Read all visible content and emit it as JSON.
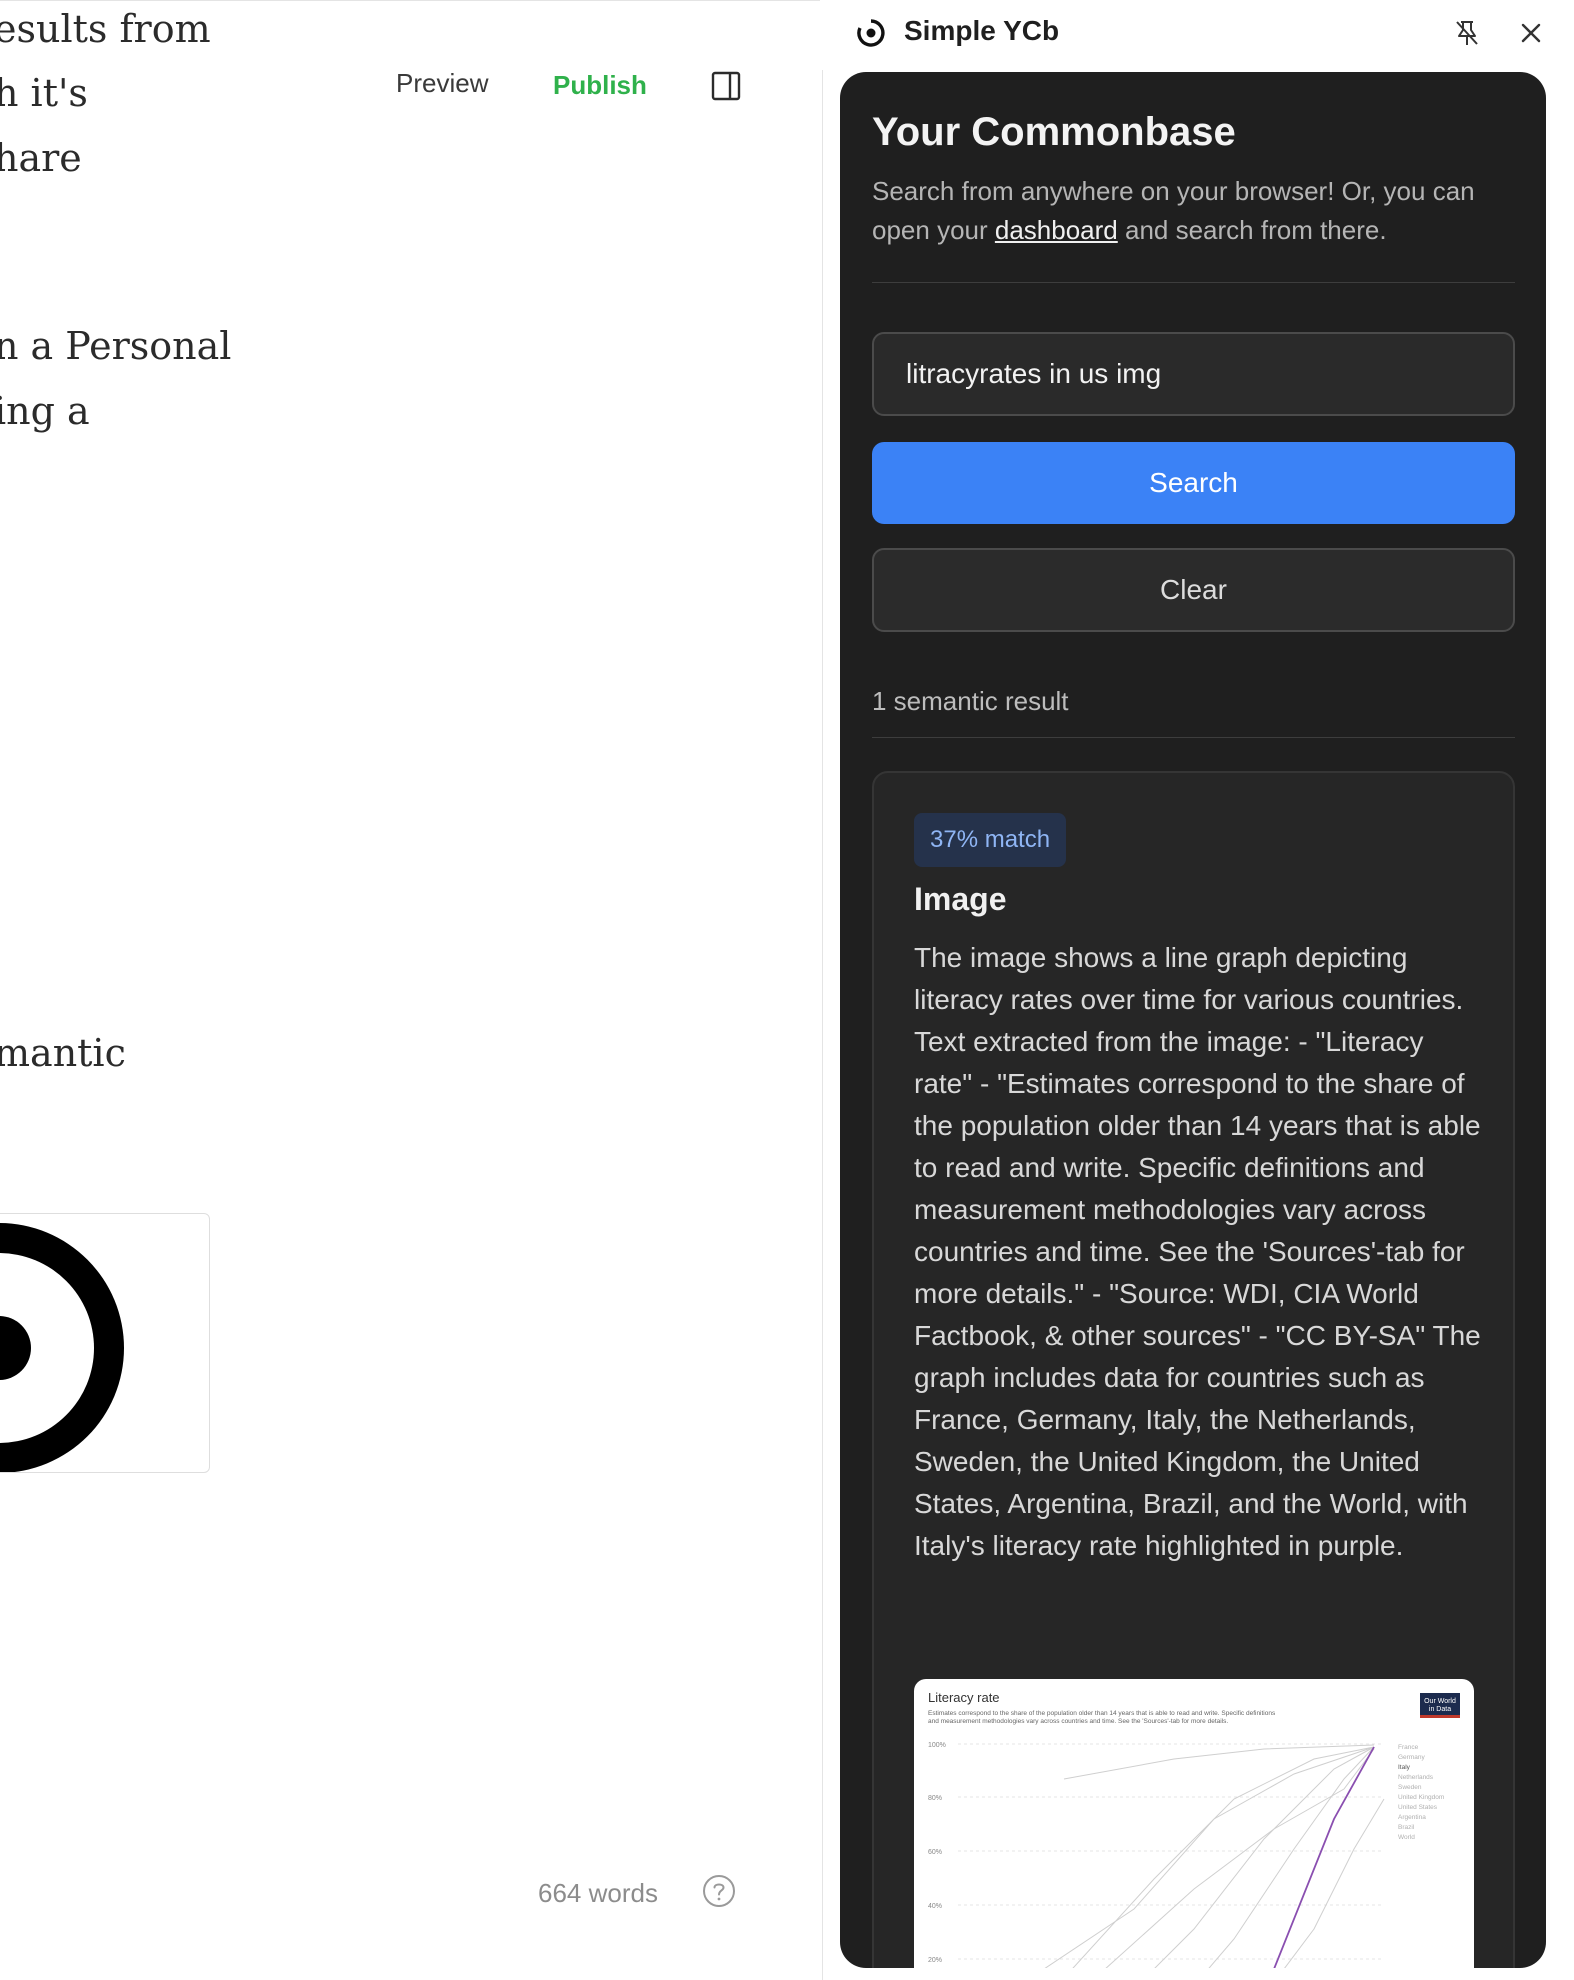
{
  "editor": {
    "text_fragments": [
      "esults from",
      "h it's",
      "hare",
      "n a Personal",
      "ing a",
      "mantic"
    ],
    "preview_label": "Preview",
    "publish_label": "Publish",
    "word_count": "664 words"
  },
  "side_panel": {
    "app_title": "Simple YCb",
    "heading": "Your Commonbase",
    "description_before": "Search from anywhere on your browser! Or, you can open your ",
    "description_link": "dashboard",
    "description_after": " and search from there.",
    "search": {
      "value": "litracyrates in us img",
      "button_label": "Search",
      "clear_label": "Clear"
    },
    "result_count": "1 semantic result",
    "result": {
      "match": "37% match",
      "title": "Image",
      "body": "The image shows a line graph depicting literacy rates over time for various countries. Text extracted from the image: - \"Literacy rate\" - \"Estimates correspond to the share of the population older than 14 years that is able to read and write. Specific definitions and measurement methodologies vary across countries and time. See the 'Sources'-tab for more details.\" - \"Source: WDI, CIA World Factbook, & other sources\" - \"CC BY-SA\" The graph includes data for countries such as France, Germany, Italy, the Netherlands, Sweden, the United Kingdom, the United States, Argentina, Brazil, and the World, with Italy's literacy rate highlighted in purple.",
      "thumbnail": {
        "title": "Literacy rate",
        "subtitle_1": "Estimates correspond to the share of the population older than 14 years that is able to read and write. Specific definitions",
        "subtitle_2": "and measurement methodologies vary across countries and time. See the 'Sources'-tab for more details.",
        "logo_line_1": "Our World",
        "logo_line_2": "in Data",
        "y_ticks": [
          "100%",
          "80%",
          "60%",
          "40%",
          "20%"
        ],
        "legend": [
          "France",
          "Germany",
          "Italy",
          "Netherlands",
          "Sweden",
          "United Kingdom",
          "United States",
          "Argentina",
          "Brazil",
          "World"
        ]
      }
    }
  },
  "colors": {
    "publish": "#2fb14b",
    "search_button": "#3b82f6",
    "panel_bg": "#1f1f1f",
    "badge_text": "#8fb5f4",
    "highlight_line": "#8a4fb0"
  }
}
